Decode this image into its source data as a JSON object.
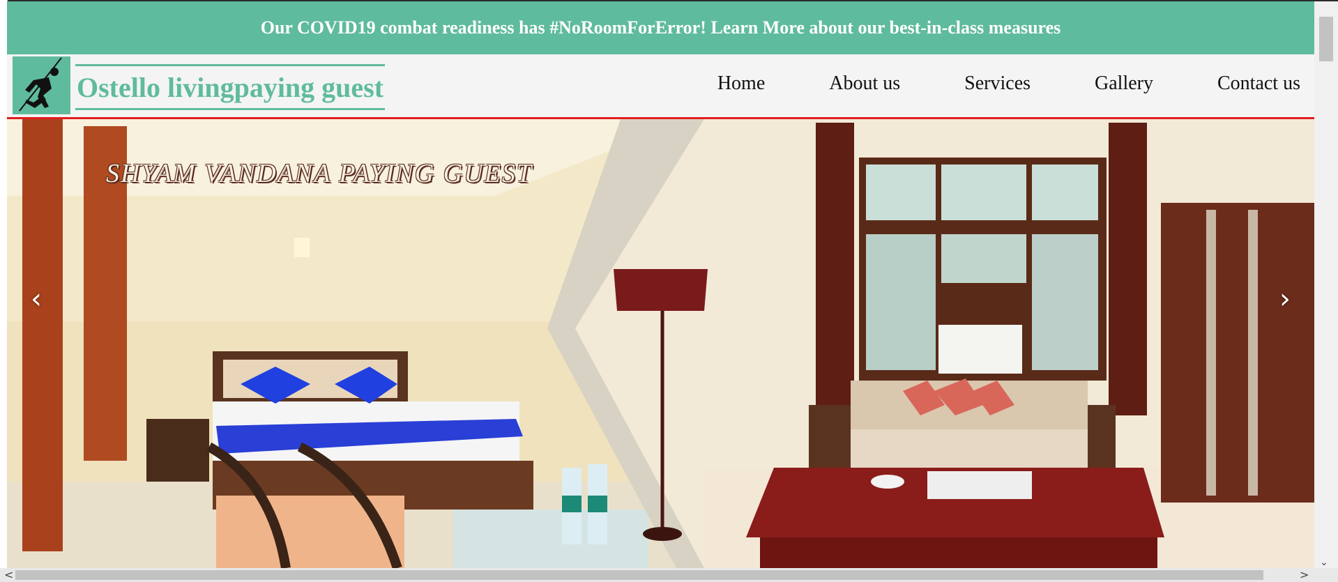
{
  "announcement": {
    "text": "Our COVID19 combat readiness has #NoRoomForError! Learn More about our best-in-class measures"
  },
  "header": {
    "brand": "Ostello livingpaying guest",
    "logo_icon": "sprinter-icon",
    "nav": [
      {
        "label": "Home"
      },
      {
        "label": "About us"
      },
      {
        "label": "Services"
      },
      {
        "label": "Gallery"
      },
      {
        "label": "Contact us"
      }
    ]
  },
  "hero": {
    "title": "SHYAM VANDANA PAYING GUEST",
    "prev_icon": "chevron-left-icon",
    "next_icon": "chevron-right-icon",
    "prev_glyph": "‹",
    "next_glyph": "›"
  },
  "scrollbars": {
    "left_glyph": "<",
    "right_glyph": ">",
    "down_glyph": "⌄"
  },
  "colors": {
    "accent": "#5fbb9d",
    "divider": "#e01e1e"
  }
}
